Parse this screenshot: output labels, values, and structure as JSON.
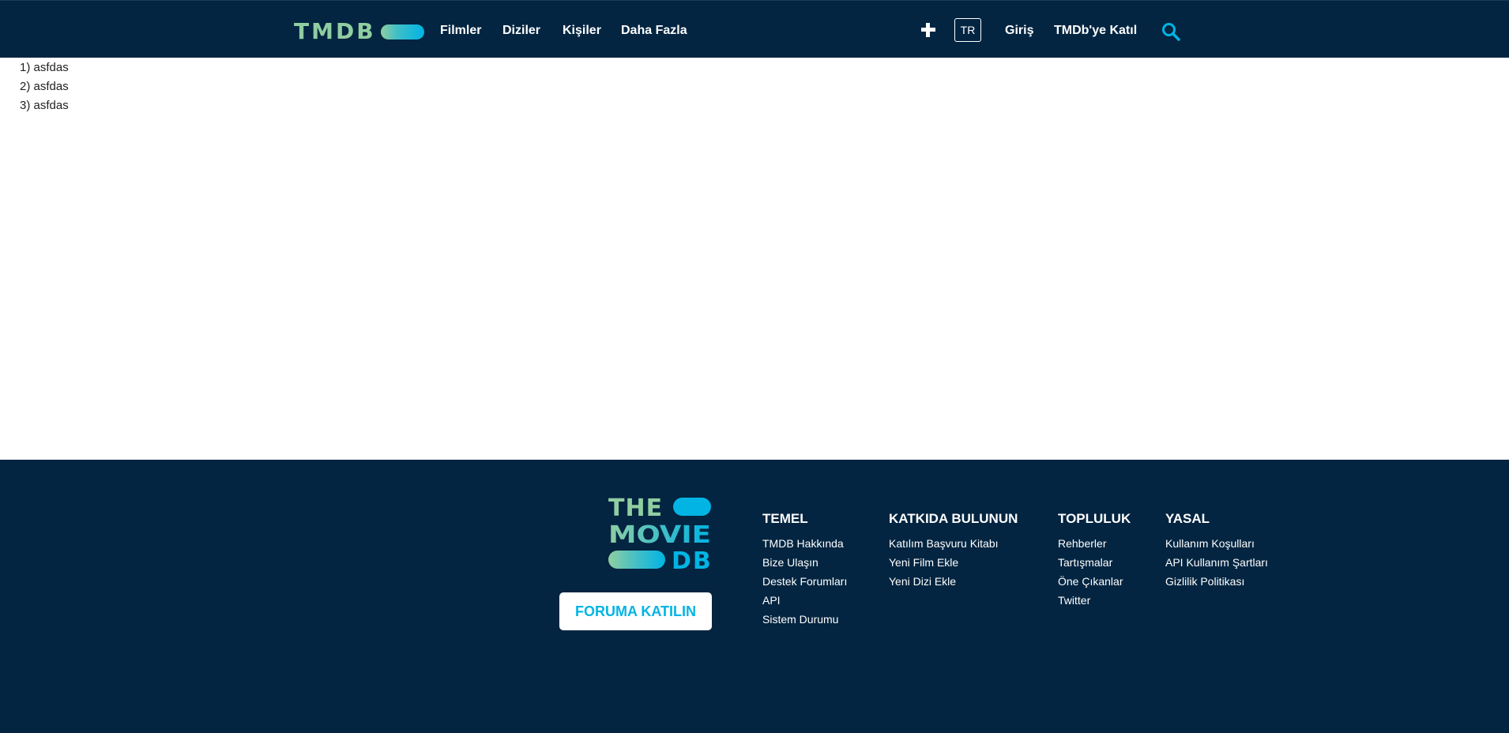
{
  "header": {
    "logo_text": "TMDB",
    "nav": [
      "Filmler",
      "Diziler",
      "Kişiler",
      "Daha Fazla"
    ],
    "lang": "TR",
    "login": "Giriş",
    "join": "TMDb'ye Katıl",
    "icons": [
      "plus-icon",
      "search-icon"
    ],
    "colors": {
      "navy": "#032541",
      "green": "#90cea1",
      "blue": "#01b4e4"
    }
  },
  "content": {
    "items": [
      "1) asfdas",
      "2) asfdas",
      "3) asfdas"
    ]
  },
  "footer": {
    "logo_lines": [
      "THE",
      "MOVIE",
      "DB"
    ],
    "join_button": "FORUMA KATILIN",
    "columns": [
      {
        "title": "TEMEL",
        "links": [
          "TMDB Hakkında",
          "Bize Ulaşın",
          "Destek Forumları",
          "API",
          "Sistem Durumu"
        ]
      },
      {
        "title": "KATKIDA BULUNUN",
        "links": [
          "Katılım Başvuru Kitabı",
          "Yeni Film Ekle",
          "Yeni Dizi Ekle"
        ]
      },
      {
        "title": "TOPLULUK",
        "links": [
          "Rehberler",
          "Tartışmalar",
          "Öne Çıkanlar",
          "Twitter"
        ]
      },
      {
        "title": "YASAL",
        "links": [
          "Kullanım Koşulları",
          "API Kullanım Şartları",
          "Gizlilik Politikası"
        ]
      }
    ]
  }
}
